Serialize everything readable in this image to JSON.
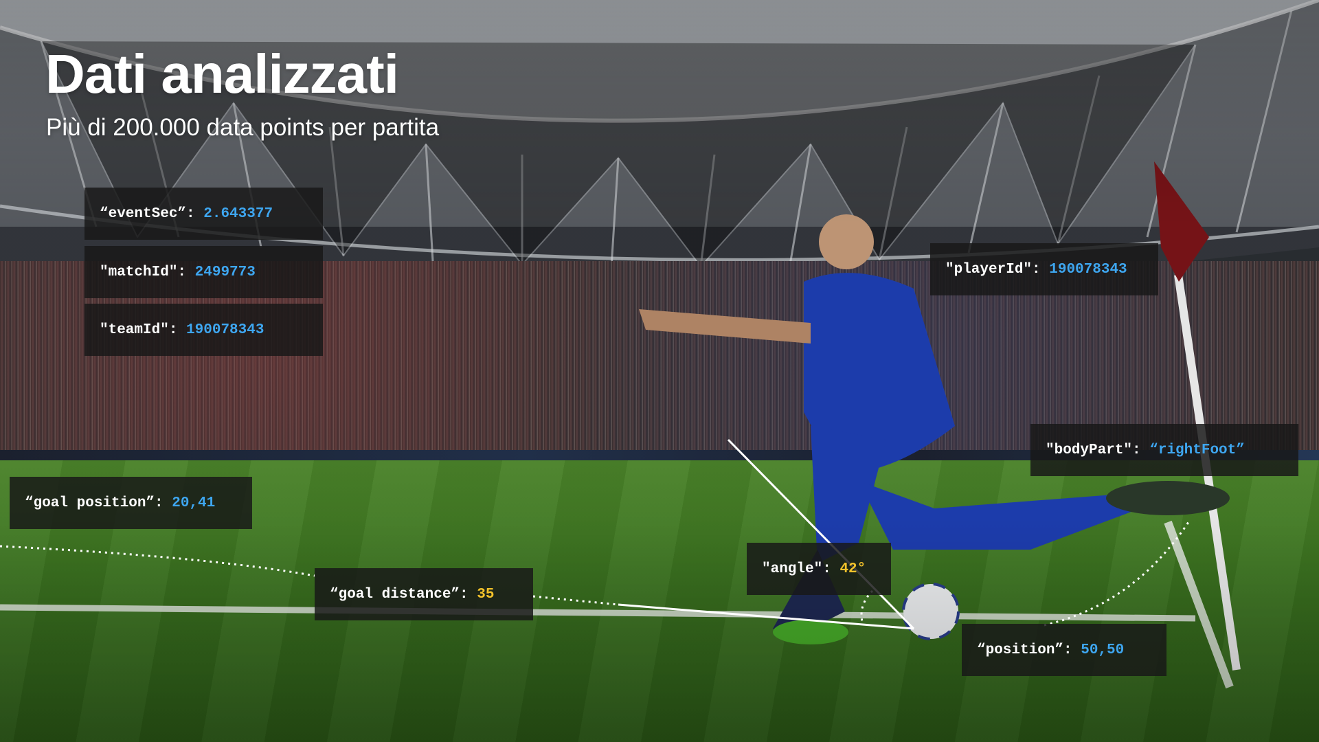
{
  "slide": {
    "title": "Dati analizzati",
    "subtitle": "Più di 200.000 data points per partita"
  },
  "labels": {
    "event_sec": {
      "key": "“eventSec”:",
      "value": "2.643377"
    },
    "match_id": {
      "key": "\"matchId\":",
      "value": "2499773"
    },
    "team_id": {
      "key": "\"teamId\":",
      "value": "190078343"
    },
    "player_id": {
      "key": "\"playerId\":",
      "value": "190078343"
    },
    "body_part": {
      "key": "\"bodyPart\":",
      "value": "“rightFoot”"
    },
    "goal_position": {
      "key": "“goal position”:",
      "value": "20,41"
    },
    "angle": {
      "key": "\"angle\":",
      "value": "42°"
    },
    "goal_distance": {
      "key": "“goal distance”:",
      "value": "35"
    },
    "position": {
      "key": "“position”:",
      "value": "50,50"
    }
  },
  "colors": {
    "value_blue": "#3ea6f0",
    "value_yellow": "#f3c22b",
    "label_bg": "#181818"
  }
}
